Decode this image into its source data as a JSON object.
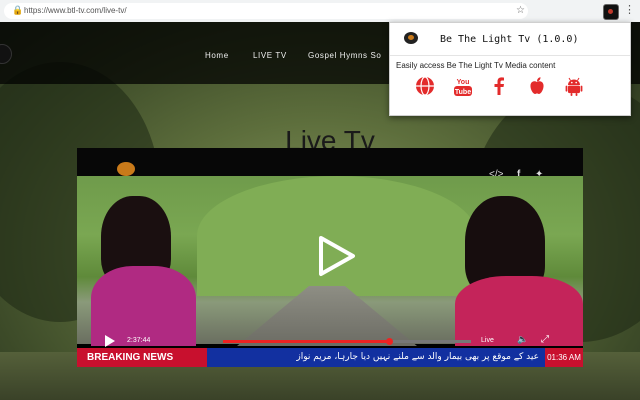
{
  "browser": {
    "url": "https://www.btl-tv.com/live-tv/"
  },
  "site": {
    "nav": [
      "Home",
      "LIVE TV",
      "Gospel Hymns So"
    ],
    "heading": "Live Tv"
  },
  "player": {
    "elapsed": "2:37:44",
    "progress_fraction": 0.67,
    "live_label": "Live",
    "breaking_label": "BREAKING NEWS",
    "ticker_text": "عید کے موقع پر بھی بیمار والد سے ملنے نہیں دیا جارہا، مریم نواز",
    "clock": "01:36 AM"
  },
  "popup": {
    "title": "Be The Light Tv (1.0.0)",
    "description": "Easily access Be The Light Tv Media content",
    "links": [
      {
        "icon": "web-globe-icon",
        "color": "#e32b2b"
      },
      {
        "icon": "youtube-icon",
        "color": "#e32b2b"
      },
      {
        "icon": "facebook-icon",
        "color": "#e32b2b"
      },
      {
        "icon": "apple-icon",
        "color": "#e32b2b"
      },
      {
        "icon": "android-icon",
        "color": "#e32b2b"
      }
    ]
  },
  "colors": {
    "accent": "#e32b2b",
    "ticker_blue": "#1230a0",
    "breaking_red": "#c8102e"
  }
}
